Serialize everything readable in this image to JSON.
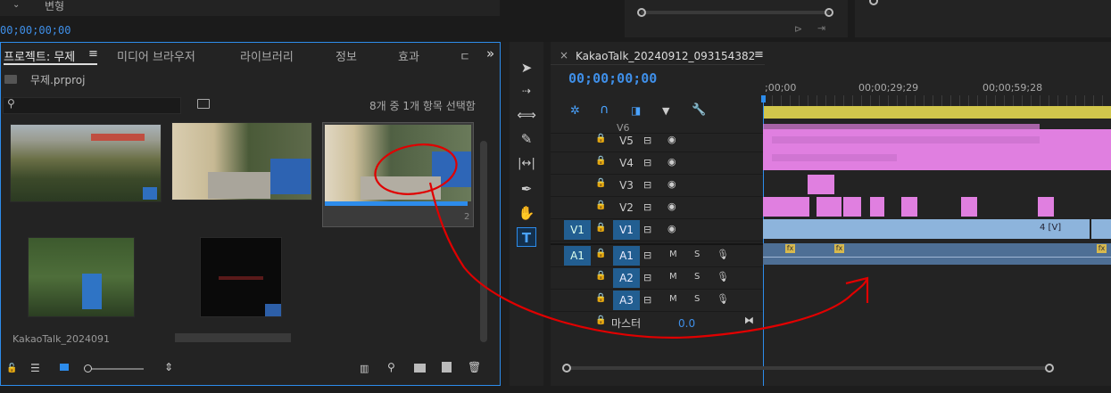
{
  "top": {
    "variant_label": "변형",
    "timecode_left": "00;00;00;00"
  },
  "project": {
    "tabs": [
      "프로젝트: 무제",
      "미디어 브라우저",
      "라이브러리",
      "정보",
      "효과",
      "ㄷ"
    ],
    "menu_glyph": "≡",
    "more_glyph": "»",
    "file_name": "무제.prproj",
    "search_placeholder": "",
    "selection_status": "8개 중 1개 항목 선택함",
    "clip_captions": [
      "KakaoTalk_2024091",
      "",
      ""
    ],
    "bottom_icons": [
      "lock-icon",
      "list-view-icon",
      "icon-view-icon",
      "zoom-slider",
      "sort-icon",
      "automate-icon",
      "find-icon",
      "new-bin-icon",
      "new-item-icon",
      "trash-icon"
    ]
  },
  "tools": [
    "selection-tool-icon",
    "track-select-icon",
    "ripple-edit-icon",
    "razor-icon",
    "slip-icon",
    "pen-icon",
    "hand-icon",
    "type-icon"
  ],
  "timeline": {
    "close_glyph": "×",
    "sequence_name": "KakaoTalk_20240912_093154382",
    "menu_glyph": "≡",
    "timecode": "00;00;00;00",
    "ruler_labels": [
      ";00;00",
      "00;00;29;29",
      "00;00;59;28"
    ],
    "video_tracks": [
      {
        "name": "V6",
        "source": ""
      },
      {
        "name": "V5",
        "source": ""
      },
      {
        "name": "V4",
        "source": ""
      },
      {
        "name": "V3",
        "source": ""
      },
      {
        "name": "V2",
        "source": ""
      },
      {
        "name": "V1",
        "source": "V1"
      }
    ],
    "audio_tracks": [
      {
        "name": "A1",
        "source": "A1"
      },
      {
        "name": "A2",
        "source": ""
      },
      {
        "name": "A3",
        "source": ""
      }
    ],
    "mute_label": "M",
    "solo_label": "S",
    "master_label": "마스터",
    "master_value": "0.0",
    "v1_clip_label": "4 [V]",
    "fx_label": "fx"
  },
  "colors": {
    "accent_blue": "#2d8ceb",
    "track_target": "#225e91",
    "clip_pink": "#e07fe0",
    "clip_blue": "#8db4dc",
    "annotation_red": "#e00000"
  }
}
